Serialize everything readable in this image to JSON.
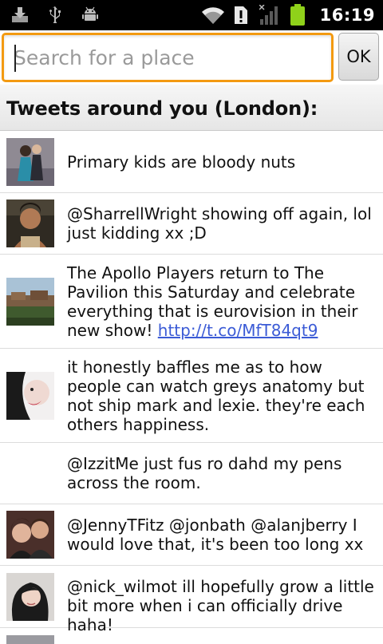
{
  "status_bar": {
    "time": "16:19",
    "left_icons": [
      "download-icon",
      "usb-icon",
      "android-debug-icon"
    ],
    "right_icons": [
      "wifi-icon",
      "sim-alert-icon",
      "signal-icon",
      "battery-icon"
    ],
    "battery_level": 0.9
  },
  "search": {
    "placeholder": "Search for a place",
    "value": "",
    "ok_label": "OK"
  },
  "header": {
    "title": "Tweets around you (London):"
  },
  "colors": {
    "accent_focus": "#f39a11",
    "link": "#3b5bd6",
    "battery": "#8fd11a"
  },
  "tweets": [
    {
      "text": "Primary kids are bloody nuts",
      "has_avatar": true
    },
    {
      "text": "@SharrellWright showing off again, lol just kidding xx ;D",
      "has_avatar": true
    },
    {
      "text": "The Apollo Players return to The Pavilion this Saturday and celebrate everything that is eurovision in their new show! ",
      "link": "http://t.co/MfT84qt9",
      "has_avatar": true
    },
    {
      "text": "it honestly baffles me as to how people can watch greys anatomy but not ship mark and lexie. they're each others happiness.",
      "has_avatar": true
    },
    {
      "text": "@IzzitMe just fus ro dahd my pens across the room.",
      "has_avatar": false
    },
    {
      "text": "@JennyTFitz @jonbath @alanjberry I would love that, it's been too long xx",
      "has_avatar": true
    },
    {
      "text": "@nick_wilmot ill hopefully grow a little bit more when i can officially drive haha!",
      "has_avatar": true
    }
  ]
}
